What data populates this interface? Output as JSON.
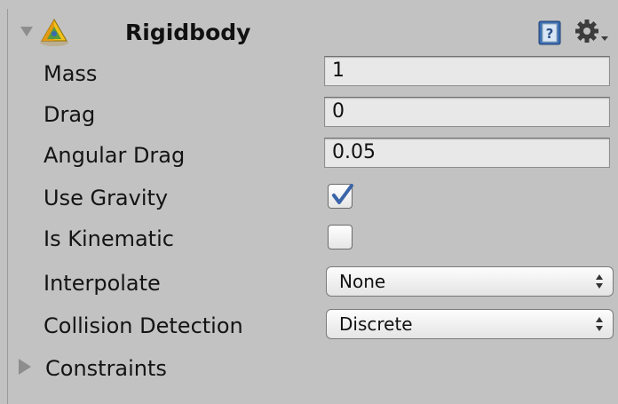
{
  "component": {
    "title": "Rigidbody",
    "icon": "rigidbody-icon",
    "help_icon": "help-book-icon",
    "settings_icon": "gear-icon"
  },
  "fields": {
    "mass": {
      "label": "Mass",
      "value": "1"
    },
    "drag": {
      "label": "Drag",
      "value": "0"
    },
    "angular_drag": {
      "label": "Angular Drag",
      "value": "0.05"
    },
    "use_gravity": {
      "label": "Use Gravity",
      "checked": true
    },
    "is_kinematic": {
      "label": "Is Kinematic",
      "checked": false
    },
    "interpolate": {
      "label": "Interpolate",
      "value": "None"
    },
    "collision_detection": {
      "label": "Collision Detection",
      "value": "Discrete"
    }
  },
  "constraints": {
    "label": "Constraints",
    "expanded": false
  },
  "colors": {
    "panel_bg": "#c2c2c2",
    "checkmark": "#3a64a8",
    "field_bg": "#e8e8e8"
  }
}
